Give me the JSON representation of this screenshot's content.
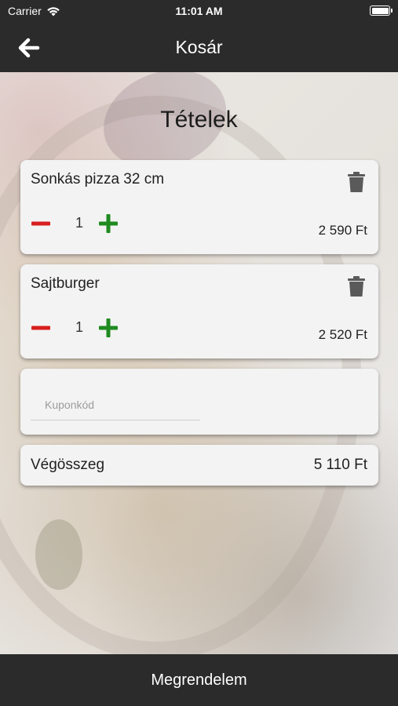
{
  "status_bar": {
    "carrier": "Carrier",
    "time": "11:01 AM"
  },
  "nav": {
    "title": "Kosár",
    "back_icon": "arrow-left-icon"
  },
  "section": {
    "title": "Tételek"
  },
  "items": [
    {
      "name": "Sonkás pizza 32 cm",
      "quantity": "1",
      "price": "2 590 Ft"
    },
    {
      "name": "Sajtburger",
      "quantity": "1",
      "price": "2 520 Ft"
    }
  ],
  "coupon": {
    "placeholder": "Kuponkód",
    "value": ""
  },
  "total": {
    "label": "Végösszeg",
    "value": "5 110 Ft"
  },
  "order_button": {
    "label": "Megrendelem"
  },
  "colors": {
    "bar": "#2b2b2b",
    "minus": "#d81e1e",
    "plus": "#1f8a1f",
    "card": "#f3f3f3"
  }
}
